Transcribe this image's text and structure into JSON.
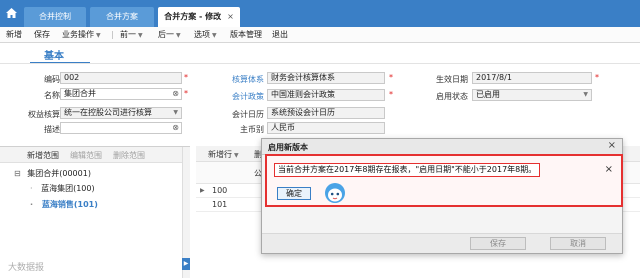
{
  "tabs": [
    {
      "label": "合并控制",
      "active": false
    },
    {
      "label": "合并方案",
      "active": false
    },
    {
      "label": "合并方案 - 修改",
      "active": true,
      "close": "×"
    }
  ],
  "toolbar": [
    {
      "label": "新增",
      "dropdown": false
    },
    {
      "label": "保存",
      "dropdown": false
    },
    {
      "label": "业务操作",
      "dropdown": true
    },
    {
      "label": "前一",
      "dropdown": true
    },
    {
      "label": "后一",
      "dropdown": true
    },
    {
      "label": "选项",
      "dropdown": true
    },
    {
      "label": "版本管理",
      "dropdown": false
    },
    {
      "label": "退出",
      "dropdown": false
    }
  ],
  "section_tab": "基本",
  "form": {
    "code_label": "编码",
    "code_value": "002",
    "name_label": "名称",
    "name_value": "集团合并",
    "equity_label": "权益核算",
    "equity_value": "统一在控股公司进行核算",
    "desc_label": "描述",
    "desc_value": "",
    "acct_system_label": "核算体系",
    "acct_system_value": "财务会计核算体系",
    "acct_policy_label": "会计政策",
    "acct_policy_value": "中国准则会计政策",
    "acct_calendar_label": "会计日历",
    "acct_calendar_value": "系统预设会计日历",
    "currency_label": "主币别",
    "currency_value": "人民币",
    "effective_date_label": "生效日期",
    "effective_date_value": "2017/8/1",
    "status_label": "启用状态",
    "status_value": "已启用"
  },
  "tree": {
    "buttons": [
      {
        "label": "新增范围",
        "enabled": true
      },
      {
        "label": "编辑范围",
        "enabled": false
      },
      {
        "label": "删除范围",
        "enabled": false
      }
    ],
    "root": "集团合并(00001)",
    "children": [
      {
        "label": "蓝海集团(100)",
        "selected": false
      },
      {
        "label": "蓝海销售(101)",
        "selected": true
      }
    ]
  },
  "grid": {
    "toolbar_new": "新增行",
    "toolbar_partial": "删",
    "col_partial": "公",
    "rows": [
      "100",
      "101"
    ]
  },
  "dialog": {
    "title": "启用新版本",
    "save": "保存",
    "cancel": "取消"
  },
  "alert": {
    "message": "当前合并方案在2017年8期存在报表，\"启用日期\"不能小于2017年8期。",
    "ok": "确定"
  },
  "watermark": "大数据报",
  "colors": {
    "brand_blue": "#3a7fc6",
    "alert_red": "#e53030",
    "required_red": "#e02020"
  }
}
